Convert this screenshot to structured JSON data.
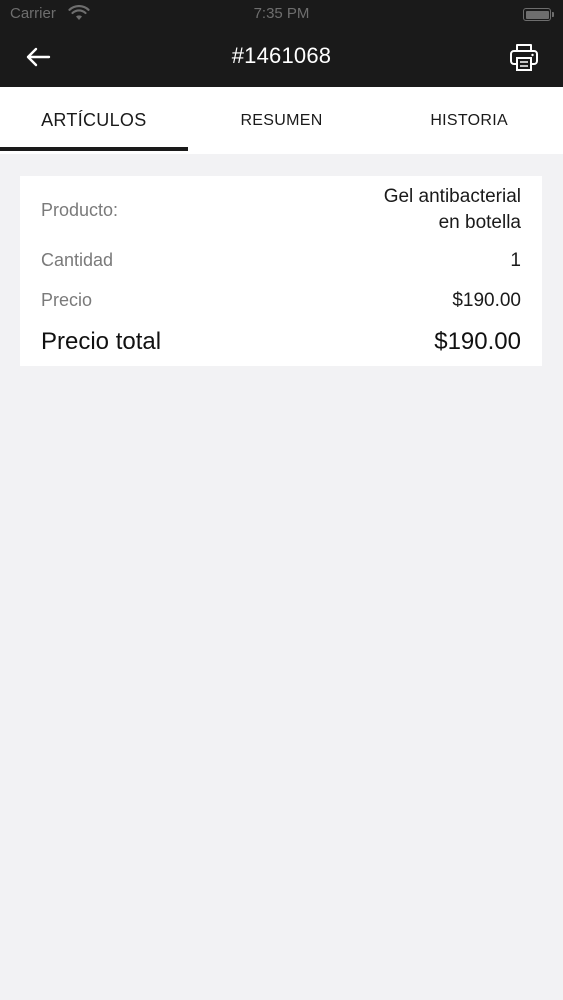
{
  "status_bar": {
    "carrier": "Carrier",
    "time": "7:35 PM"
  },
  "nav": {
    "title": "#1461068",
    "back_icon": "back-arrow-icon",
    "print_icon": "printer-icon"
  },
  "tabs": [
    {
      "label": "ARTÍCULOS",
      "active": true
    },
    {
      "label": "RESUMEN",
      "active": false
    },
    {
      "label": "HISTORIA",
      "active": false
    }
  ],
  "item": {
    "product_label": "Producto:",
    "product_line1": "Gel antibacterial",
    "product_line2": "en botella",
    "quantity_label": "Cantidad",
    "quantity_value": "1",
    "price_label": "Precio",
    "price_value": "$190.00",
    "total_label": "Precio total",
    "total_value": "$190.00"
  },
  "colors": {
    "header_bg": "#1a1a1a",
    "page_bg": "#f2f2f4",
    "card_bg": "#ffffff",
    "label_gray": "#7a7a7a"
  }
}
